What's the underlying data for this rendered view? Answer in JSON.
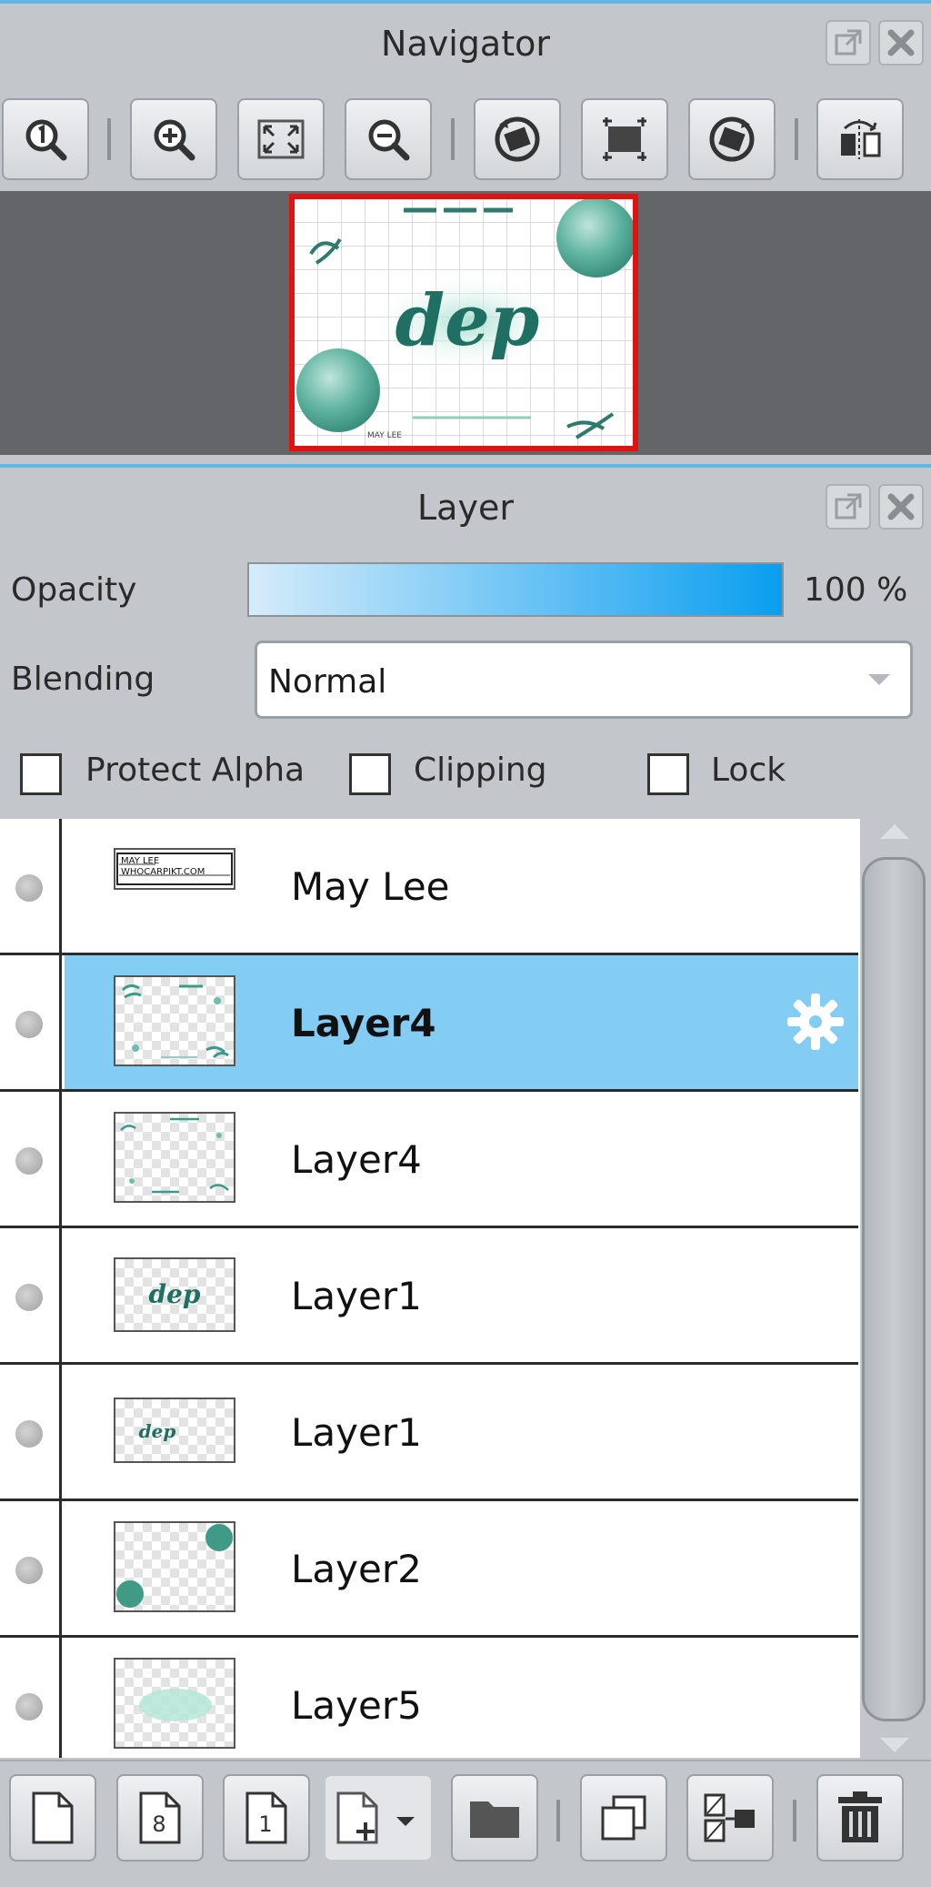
{
  "navigator": {
    "title": "Navigator",
    "tools": [
      {
        "name": "actual-size-icon"
      },
      {
        "name": "zoom-in-icon"
      },
      {
        "name": "fit-to-window-icon"
      },
      {
        "name": "zoom-out-icon"
      },
      {
        "name": "rotate-left-icon"
      },
      {
        "name": "reset-view-icon"
      },
      {
        "name": "rotate-right-icon"
      },
      {
        "name": "flip-horizontal-icon"
      }
    ],
    "preview": {
      "logo_text": "dep",
      "footer_text": "MAY LEE",
      "frame_color": "#e11212"
    }
  },
  "layer_panel": {
    "title": "Layer",
    "opacity_label": "Opacity",
    "opacity_value": "100 %",
    "blending_label": "Blending",
    "blending_value": "Normal",
    "checkboxes": {
      "protect_alpha": {
        "label": "Protect Alpha",
        "checked": false
      },
      "clipping": {
        "label": "Clipping",
        "checked": false
      },
      "lock": {
        "label": "Lock",
        "checked": false
      }
    },
    "layers": [
      {
        "name": "May Lee",
        "selected": false,
        "thumb": "text",
        "thumb_text": "MAY LEE\nWHOCARPIKT.COM"
      },
      {
        "name": "Layer4",
        "selected": true,
        "thumb": "frame"
      },
      {
        "name": "Layer4",
        "selected": false,
        "thumb": "frame2"
      },
      {
        "name": "Layer1",
        "selected": false,
        "thumb": "logo",
        "thumb_text": "dep"
      },
      {
        "name": "Layer1",
        "selected": false,
        "thumb": "logo-small",
        "thumb_text": "dep"
      },
      {
        "name": "Layer2",
        "selected": false,
        "thumb": "balloons"
      },
      {
        "name": "Layer5",
        "selected": false,
        "thumb": "blob"
      }
    ],
    "footer_tools": [
      {
        "name": "new-raster-layer-icon"
      },
      {
        "name": "new-8bit-layer-icon"
      },
      {
        "name": "new-1bit-layer-icon"
      },
      {
        "name": "add-layer-dropdown-icon"
      },
      {
        "name": "new-folder-icon"
      },
      {
        "name": "duplicate-layer-icon"
      },
      {
        "name": "merge-layer-icon"
      },
      {
        "name": "delete-layer-icon"
      }
    ]
  },
  "colors": {
    "accent": "#0a9ef0",
    "selected_row": "#83cdf5",
    "panel_bg": "#c3c6ca",
    "teal": "#3a9c88"
  }
}
